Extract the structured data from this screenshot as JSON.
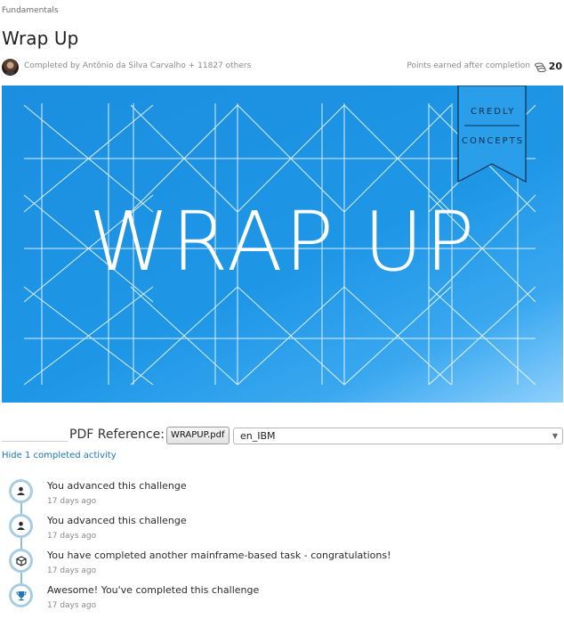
{
  "breadcrumb": "Fundamentals",
  "title": "Wrap Up",
  "completed_by": "Completed by Antônio da Silva Carvalho + 11827 others",
  "points": {
    "label": "Points earned after completion",
    "value": "20",
    "icon": "coins-icon"
  },
  "hero": {
    "title": "WRAP UP",
    "ribbon_top": "CREDLY",
    "ribbon_bottom": "CONCEPTS",
    "colors": {
      "background": "#1e96e6",
      "ribbon": "#1e96e6",
      "lines": "#ffffff"
    }
  },
  "pdf": {
    "label": "PDF Reference:",
    "file_button": "WRAPUP.pdf",
    "language_selected": "en_IBM"
  },
  "hide_activity_link": "Hide 1 completed activity",
  "timeline": [
    {
      "text": "You advanced this challenge",
      "time": "17 days ago",
      "icon": "person-icon"
    },
    {
      "text": "You advanced this challenge",
      "time": "17 days ago",
      "icon": "person-icon"
    },
    {
      "text": "You have completed another mainframe-based task - congratulations!",
      "time": "17 days ago",
      "icon": "cube-icon"
    },
    {
      "text": "Awesome! You've completed this challenge",
      "time": "17 days ago",
      "icon": "trophy-icon"
    }
  ]
}
